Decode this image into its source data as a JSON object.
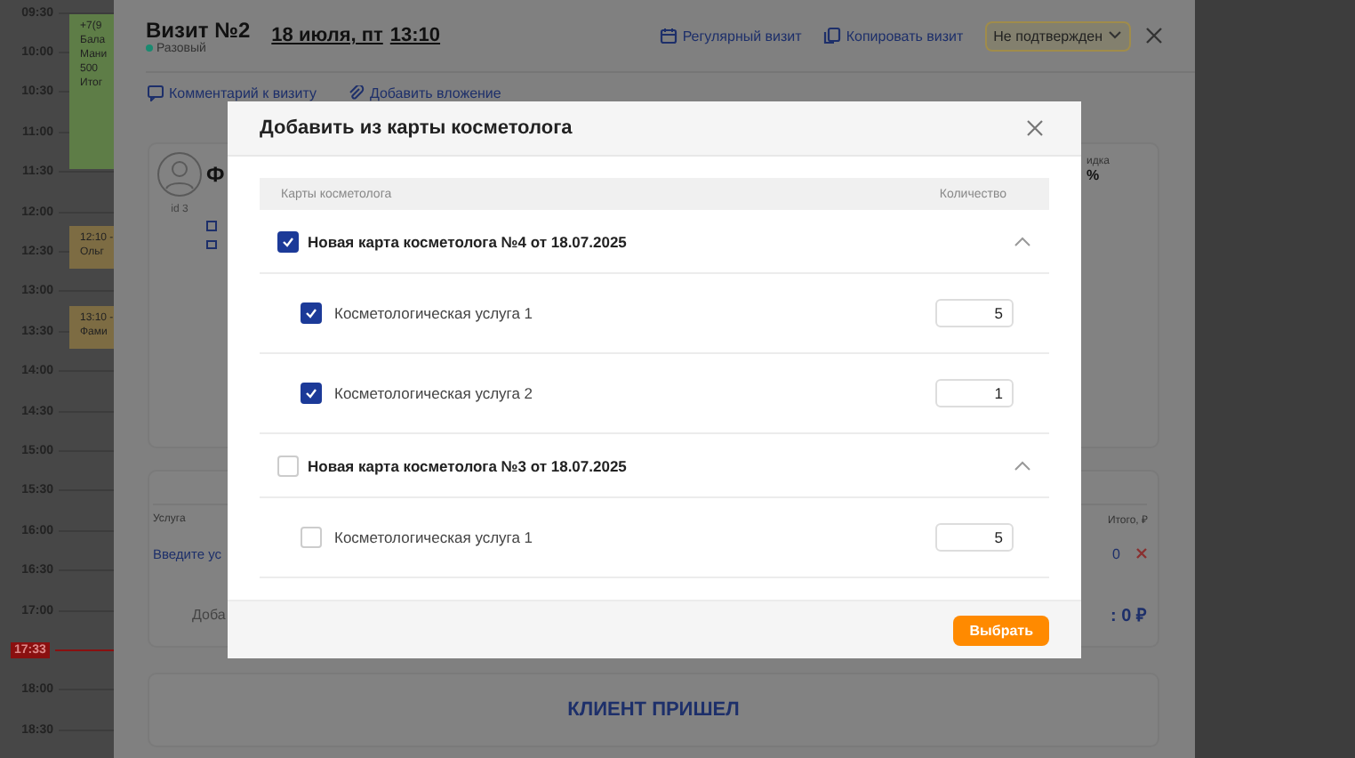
{
  "timeline": {
    "slots": [
      {
        "kind": "time",
        "label": "09:30"
      },
      {
        "kind": "time",
        "label": "10:00"
      },
      {
        "kind": "time",
        "label": "10:30"
      },
      {
        "kind": "time",
        "label": "11:00"
      },
      {
        "kind": "time",
        "label": "11:30"
      },
      {
        "kind": "time",
        "label": "12:00"
      },
      {
        "kind": "time",
        "label": "12:30"
      },
      {
        "kind": "time",
        "label": "13:00"
      },
      {
        "kind": "time",
        "label": "13:30"
      },
      {
        "kind": "time",
        "label": "14:00"
      },
      {
        "kind": "time",
        "label": "14:30"
      },
      {
        "kind": "time",
        "label": "15:00"
      },
      {
        "kind": "time",
        "label": "15:30"
      },
      {
        "kind": "time",
        "label": "16:00"
      },
      {
        "kind": "time",
        "label": "16:30"
      },
      {
        "kind": "time",
        "label": "17:00"
      },
      {
        "kind": "now",
        "label": "17:33"
      },
      {
        "kind": "time",
        "label": "18:00"
      },
      {
        "kind": "time",
        "label": "18:30"
      }
    ],
    "events": [
      {
        "color": "#5e7d47",
        "lines": [
          "+7(9",
          "Бала",
          "Мани",
          "500",
          "Итог"
        ]
      },
      {
        "color": "#7d6c43",
        "lines": [
          "12:10 -",
          "Ольг"
        ]
      },
      {
        "color": "#7d6c43",
        "lines": [
          "13:10 -",
          "Фами"
        ]
      }
    ]
  },
  "visit": {
    "title": "Визит №2",
    "type": "Разовый",
    "date": "18 июля, пт",
    "time": "13:10",
    "actions": [
      "Регулярный визит",
      "Копировать визит"
    ],
    "status": "Не подтвержден",
    "links": [
      "Комментарий к визиту",
      "Добавить вложение"
    ],
    "client": {
      "id": "id 3",
      "name": "Ф",
      "discount_label": "идка",
      "discount": "%"
    },
    "services": {
      "column_1": "Услуга",
      "column_2": "Итого, ₽",
      "placeholder": "Введите ус",
      "total": "0",
      "add_label": "Доба",
      "sum": ": 0 ₽"
    },
    "arrived_button": "КЛИЕНТ ПРИШЕЛ"
  },
  "modal": {
    "title": "Добавить из карты косметолога",
    "columns": [
      "Карты косметолога",
      "Количество"
    ],
    "cards": [
      {
        "title": "Новая карта косметолога №4 от 18.07.2025",
        "checked": true,
        "expanded": true,
        "items": [
          {
            "name": "Косметологическая услуга 1",
            "checked": true,
            "quantity": "5"
          },
          {
            "name": "Косметологическая услуга 2",
            "checked": true,
            "quantity": "1"
          }
        ]
      },
      {
        "title": "Новая карта косметолога №3 от 18.07.2025",
        "checked": false,
        "expanded": true,
        "items": [
          {
            "name": "Косметологическая услуга 1",
            "checked": false,
            "quantity": "5"
          }
        ]
      }
    ],
    "button": "Выбрать"
  }
}
